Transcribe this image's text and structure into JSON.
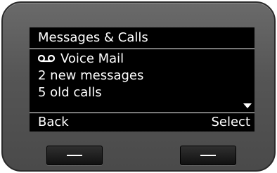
{
  "screen": {
    "title": "Messages & Calls",
    "items": [
      {
        "icon": "voicemail-icon",
        "label": "Voice Mail"
      },
      {
        "label": "2 new messages"
      },
      {
        "label": "5 old calls"
      }
    ],
    "softkeys": {
      "left": "Back",
      "right": "Select"
    }
  },
  "colors": {
    "display_background": "#000000",
    "display_text": "#ffffff",
    "housing": "#555555",
    "hardware_button": "#1a1a1a"
  }
}
